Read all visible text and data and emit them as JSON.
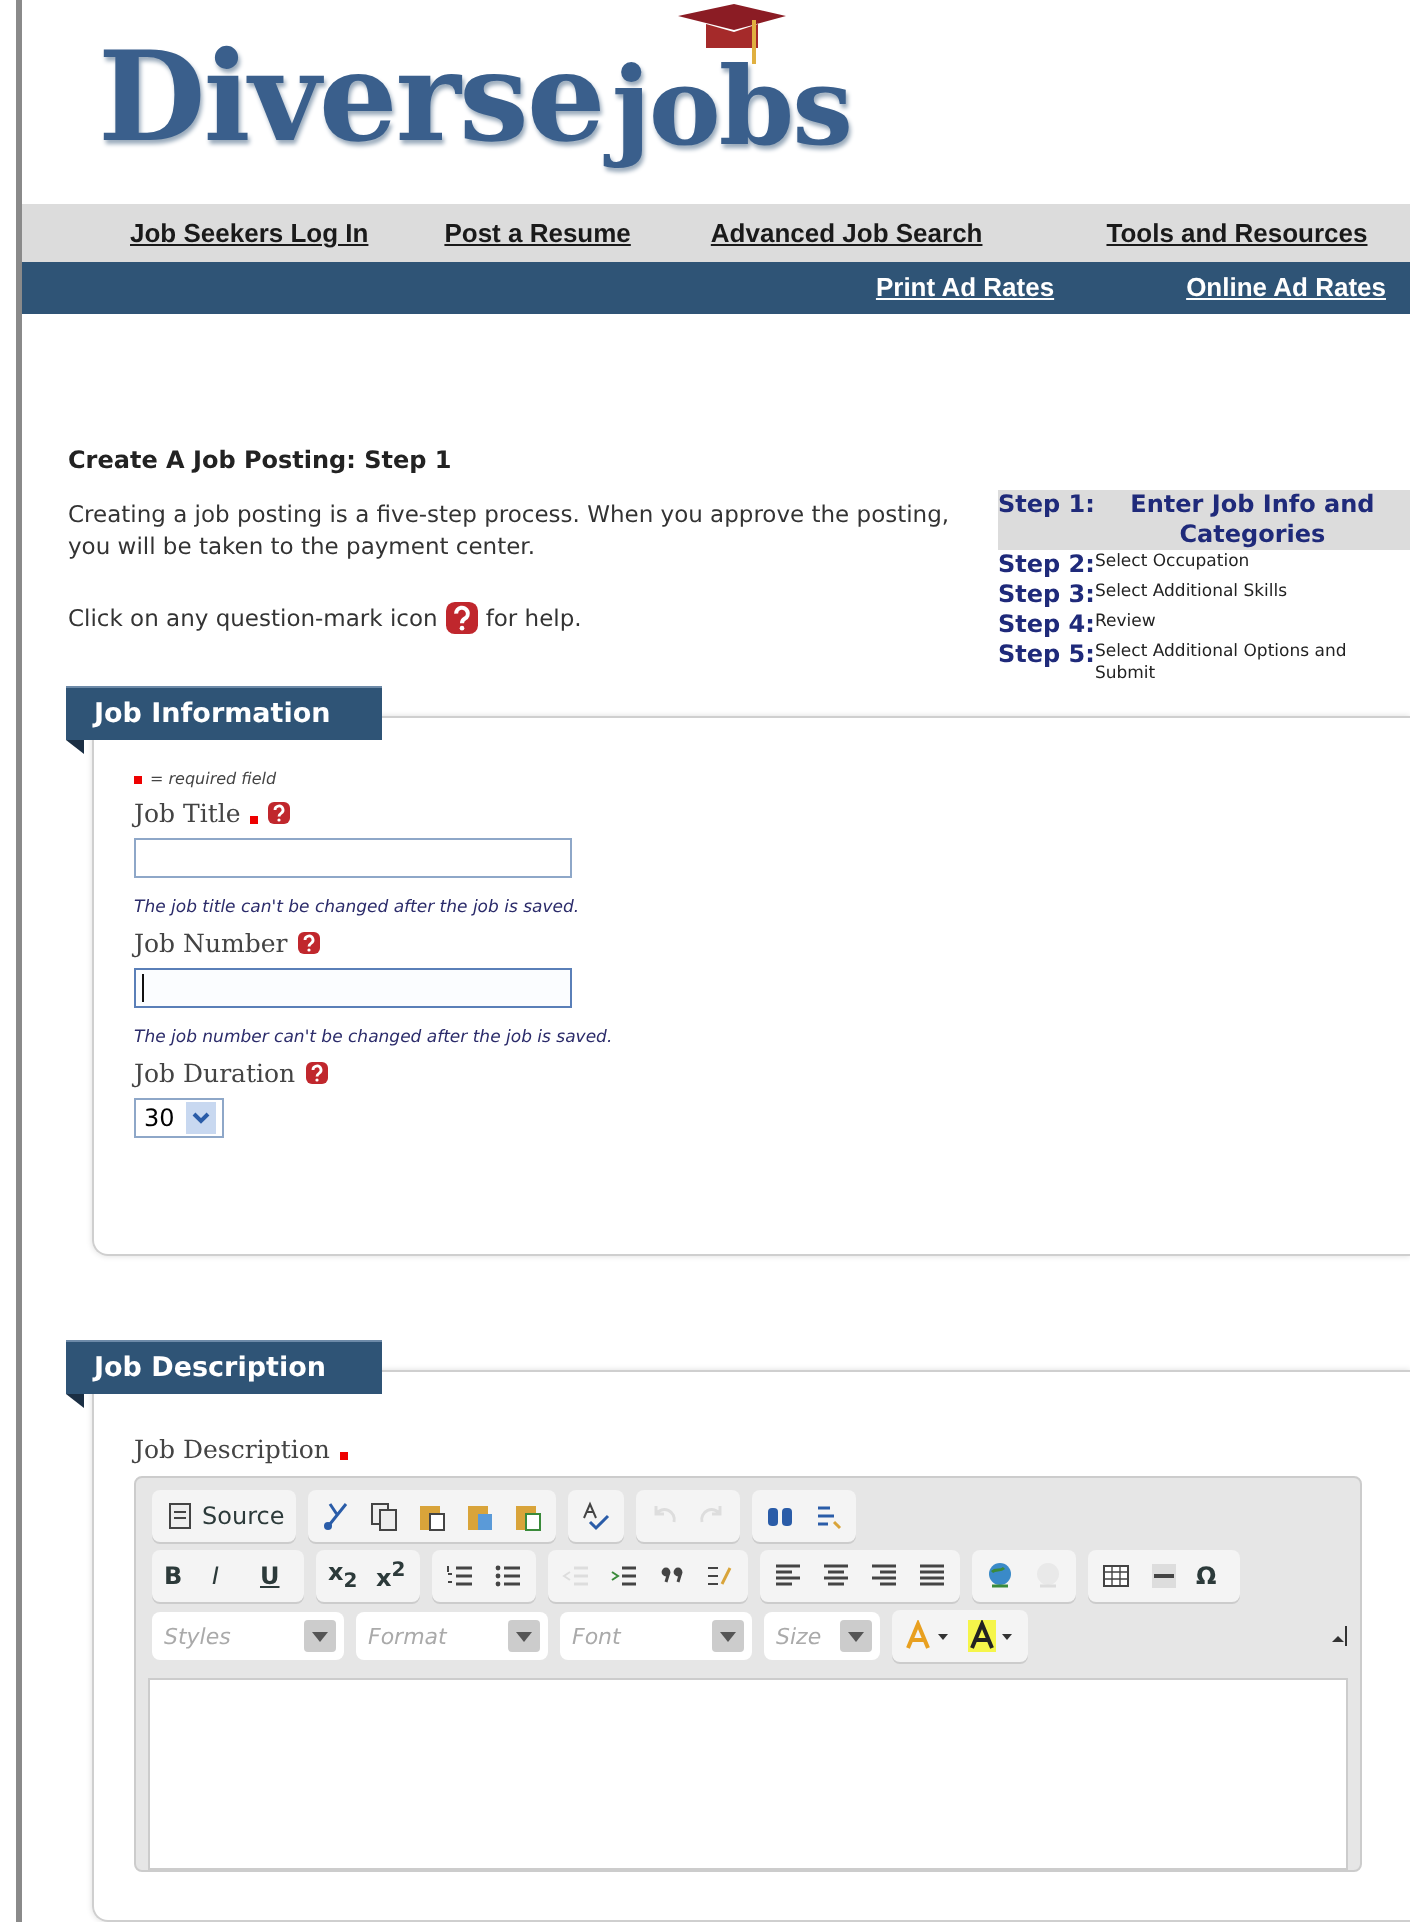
{
  "logo": {
    "word_1": "Diverse",
    "word_2": "jobs"
  },
  "nav": {
    "top_links": [
      "Job Seekers Log In",
      "Post a Resume",
      "Advanced Job Search",
      "Tools and Resources"
    ],
    "bottom_links": [
      "Print Ad Rates",
      "Online Ad Rates"
    ]
  },
  "page": {
    "title": "Create A Job Posting: Step 1",
    "intro": "Creating a job posting is a five-step process. When you approve the posting, you will be taken to the payment center.",
    "help_before": "Click on any question-mark icon",
    "help_after": "for help."
  },
  "steps": [
    {
      "number": "Step 1:",
      "label": "Enter Job Info and Categories",
      "selected": true
    },
    {
      "number": "Step 2:",
      "label": "Select Occupation",
      "selected": false
    },
    {
      "number": "Step 3:",
      "label": "Select Additional Skills",
      "selected": false
    },
    {
      "number": "Step 4:",
      "label": "Review",
      "selected": false
    },
    {
      "number": "Step 5:",
      "label": "Select Additional Options and Submit",
      "selected": false
    }
  ],
  "job_information": {
    "heading": "Job Information",
    "legend": "= required field",
    "fields": [
      {
        "kind": "text",
        "label": "Job Title",
        "required": true,
        "note": "The job title can't be changed after the job is saved.",
        "focused": false
      },
      {
        "kind": "text",
        "label": "Job Number",
        "required": false,
        "note": "The job number can't be changed after the job is saved.",
        "focused": true
      },
      {
        "kind": "select",
        "label": "Job Duration",
        "required": false,
        "value": "30"
      }
    ]
  },
  "job_description": {
    "heading": "Job Description",
    "label": "Job Description",
    "required": true,
    "toolbar_rows": [
      [
        [
          {
            "kind": "icon",
            "label": "Source",
            "disabled": false
          }
        ],
        [
          {
            "kind": "icon",
            "disabled": false
          },
          {
            "kind": "icon",
            "disabled": false
          },
          {
            "kind": "icon",
            "disabled": false
          },
          {
            "kind": "icon",
            "disabled": false
          },
          {
            "kind": "icon",
            "disabled": false
          }
        ],
        [
          {
            "kind": "icon",
            "disabled": false
          }
        ],
        [
          {
            "kind": "icon",
            "disabled": true
          },
          {
            "kind": "icon",
            "disabled": true
          }
        ],
        [
          {
            "kind": "icon",
            "disabled": false
          },
          {
            "kind": "icon",
            "disabled": false
          }
        ]
      ],
      [
        [
          {
            "kind": "glyph",
            "label": "B",
            "disabled": false
          },
          {
            "kind": "glyph",
            "label": "I",
            "disabled": false
          },
          {
            "kind": "glyph",
            "label": "U",
            "disabled": false
          }
        ],
        [
          {
            "kind": "glyph",
            "label": "x$_{2}$",
            "disabled": false
          },
          {
            "kind": "glyph",
            "label": "x$^{2}$",
            "disabled": false
          }
        ],
        [
          {
            "kind": "icon",
            "disabled": false
          },
          {
            "kind": "icon",
            "disabled": false
          }
        ],
        [
          {
            "kind": "icon",
            "disabled": true
          },
          {
            "kind": "icon",
            "disabled": false
          },
          {
            "kind": "icon",
            "disabled": false
          },
          {
            "kind": "icon",
            "disabled": false
          }
        ],
        [
          {
            "kind": "icon",
            "disabled": false
          },
          {
            "kind": "icon",
            "disabled": false
          },
          {
            "kind": "icon",
            "disabled": false
          },
          {
            "kind": "icon",
            "disabled": false
          }
        ],
        [
          {
            "kind": "icon",
            "disabled": false
          },
          {
            "kind": "icon",
            "disabled": true
          }
        ],
        [
          {
            "kind": "icon",
            "disabled": false
          },
          {
            "kind": "icon",
            "disabled": false
          },
          {
            "kind": "glyph",
            "label": "Ω",
            "disabled": false
          }
        ]
      ]
    ],
    "combos": [
      "Styles",
      "Format",
      "Font",
      "Size"
    ]
  }
}
